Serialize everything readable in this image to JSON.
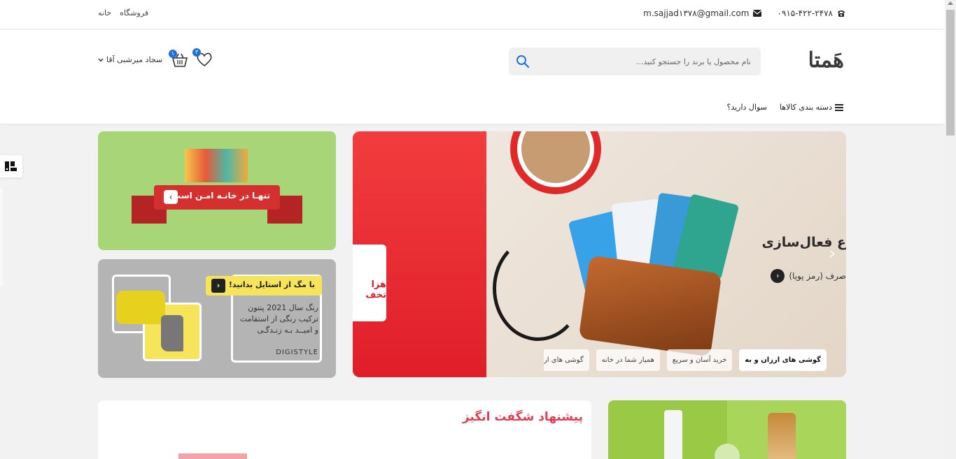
{
  "topbar": {
    "phone": "۰۹۱۵-۴۲۲-۲۴۷۸",
    "email": "m.sajjad۱۳۷۸@gmail.com",
    "links": [
      "خانه",
      "فروشگاه"
    ]
  },
  "header": {
    "logo": "هَمتا",
    "search_placeholder": "نام محصول یا برند را جستجو کنید...",
    "user_name": "سجاد میرشبی آقا",
    "cart_count": "۱",
    "wishlist_count": "۳",
    "nav": [
      "دسته بندی کالاها",
      "سوال دارید؟"
    ]
  },
  "slider": {
    "title": "ع فعال‌سازی",
    "subtitle": "صرف (رمز پویا)",
    "ticket_text": "هزا تخف",
    "chips": [
      "گوشی های ارزان و به",
      "خرید آسان و سریع",
      "همیار شما در خانه",
      "گوشی های ارزان و"
    ]
  },
  "banners": {
    "banner1": "تنهـا در خانـه امـن است!",
    "banner2_tag": "با مگ از استایل بدانید!",
    "banner2_lines": [
      "رنگ سال 2021 پنتون",
      "ترکیب رنگی از استقامت",
      "و امیــد بـه زنـدگـی"
    ],
    "banner2_brand": "DIGISTYLE"
  },
  "offer": {
    "title": "پیشنهاد شگفت انگیز"
  },
  "colors": {
    "accent": "#1e73d8",
    "offer_title": "#e53b4f",
    "slider_red": "#e01e2a",
    "banner_green": "#a8d577"
  }
}
